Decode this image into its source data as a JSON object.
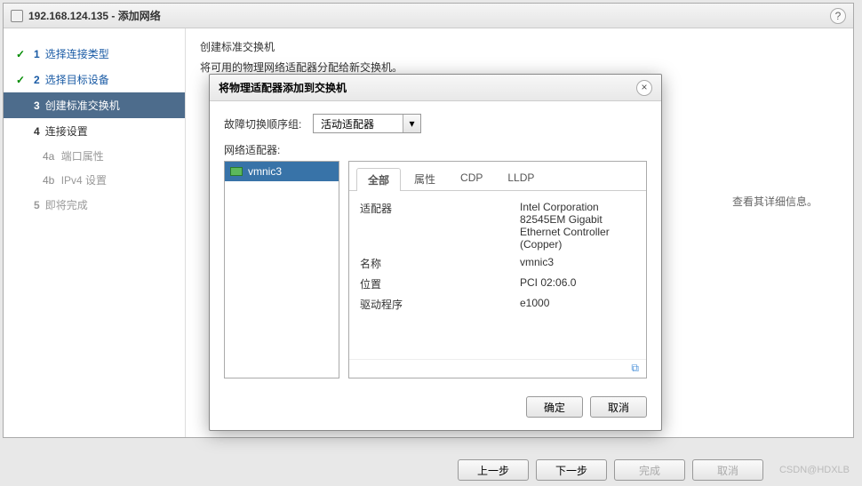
{
  "window": {
    "ip": "192.168.124.135",
    "title_suffix": " - 添加网络",
    "help": "?"
  },
  "steps": {
    "s1": "选择连接类型",
    "s2": "选择目标设备",
    "s3": "创建标准交换机",
    "s4": "连接设置",
    "s4a_num": "4a",
    "s4a": "端口属性",
    "s4b_num": "4b",
    "s4b": "IPv4 设置",
    "s5": "即将完成"
  },
  "main": {
    "title": "创建标准交换机",
    "subtitle": "将可用的物理网络适配器分配给新交换机。",
    "detail_hint": "查看其详细信息。"
  },
  "dialog": {
    "title": "将物理适配器添加到交换机",
    "close": "×",
    "failover_label": "故障切换顺序组:",
    "failover_value": "活动适配器",
    "adapter_label": "网络适配器:",
    "nic": "vmnic3",
    "tabs": {
      "all": "全部",
      "props": "属性",
      "cdp": "CDP",
      "lldp": "LLDP"
    },
    "props": {
      "adapter_label": "适配器",
      "adapter_value": "Intel Corporation 82545EM Gigabit Ethernet Controller (Copper)",
      "name_label": "名称",
      "name_value": "vmnic3",
      "location_label": "位置",
      "location_value": "PCI 02:06.0",
      "driver_label": "驱动程序",
      "driver_value": "e1000"
    },
    "ok": "确定",
    "cancel": "取消"
  },
  "footer": {
    "back": "上一步",
    "next": "下一步",
    "finish": "完成",
    "cancel": "取消",
    "watermark": "CSDN@HDXLB"
  }
}
